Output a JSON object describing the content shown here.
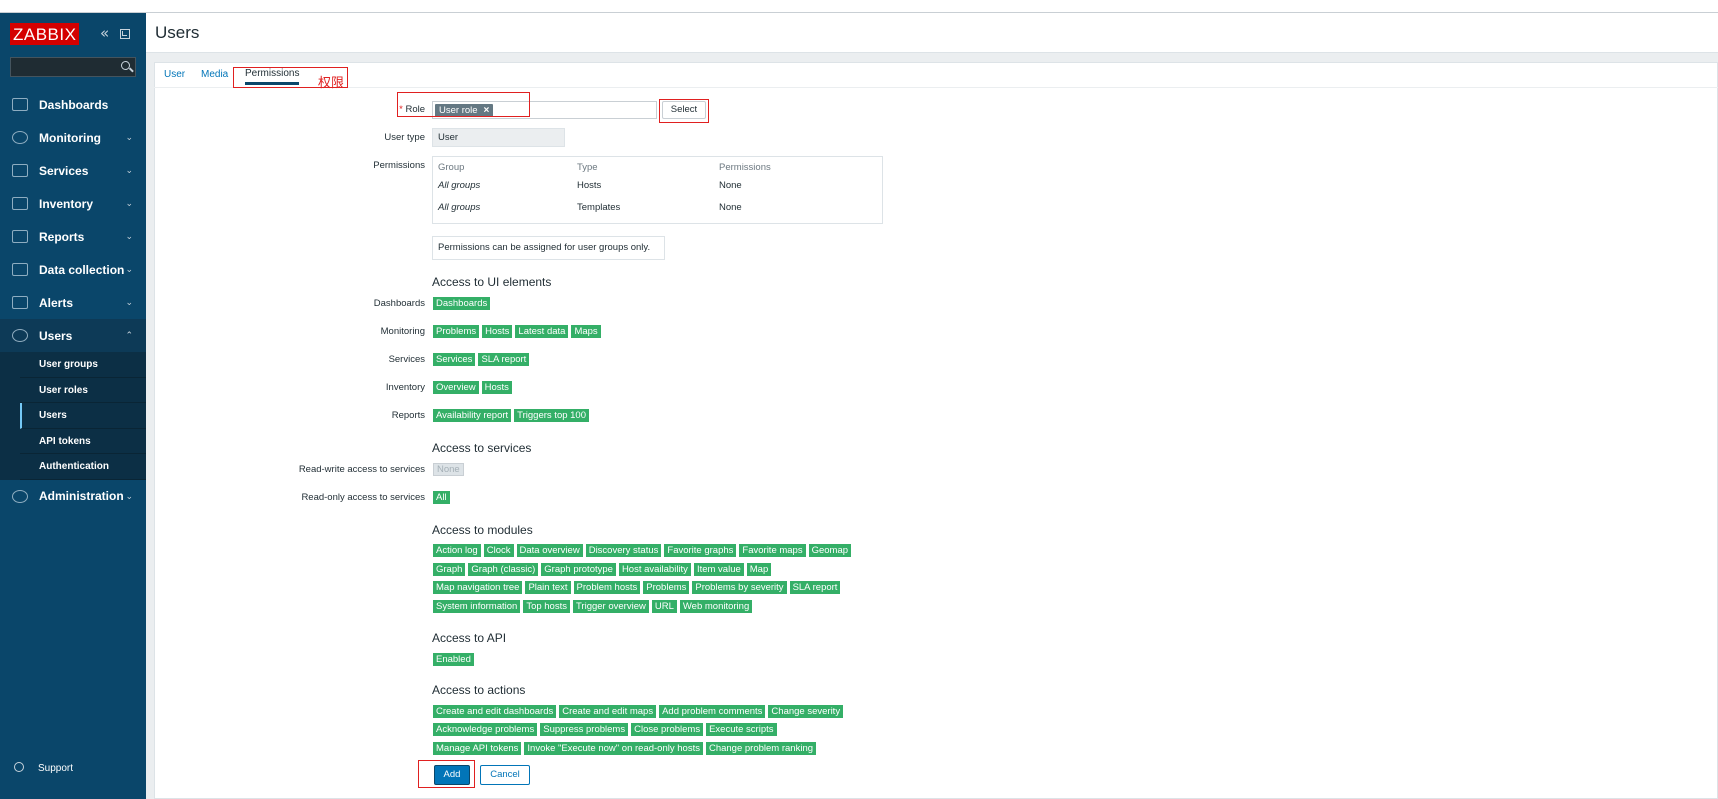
{
  "sidebar": {
    "logo": "ZABBIX",
    "menu": [
      {
        "label": "Dashboards",
        "icon": "dashboard-icon"
      },
      {
        "label": "Monitoring",
        "icon": "eye-icon"
      },
      {
        "label": "Services",
        "icon": "services-icon"
      },
      {
        "label": "Inventory",
        "icon": "list-icon"
      },
      {
        "label": "Reports",
        "icon": "report-icon"
      },
      {
        "label": "Data collection",
        "icon": "download-icon"
      },
      {
        "label": "Alerts",
        "icon": "envelope-icon"
      },
      {
        "label": "Users",
        "icon": "users-icon"
      }
    ],
    "users_submenu": [
      "User groups",
      "User roles",
      "Users",
      "API tokens",
      "Authentication"
    ],
    "administration": "Administration",
    "support": "Support"
  },
  "header": {
    "title": "Users"
  },
  "tabs": [
    "User",
    "Media",
    "Permissions"
  ],
  "annotation_text": "权限",
  "form": {
    "role_label": "Role",
    "role_required_mark": "*",
    "role_value": "User role",
    "role_remove": "×",
    "select_label": "Select",
    "user_type_label": "User type",
    "user_type_value": "User",
    "permissions_label": "Permissions",
    "perm_table": {
      "headers": [
        "Group",
        "Type",
        "Permissions"
      ],
      "rows": [
        [
          "All groups",
          "Hosts",
          "None"
        ],
        [
          "All groups",
          "Templates",
          "None"
        ]
      ]
    },
    "perm_note": "Permissions can be assigned for user groups only."
  },
  "ui_elements": {
    "title": "Access to UI elements",
    "rows": [
      {
        "label": "Dashboards",
        "tags": [
          "Dashboards"
        ]
      },
      {
        "label": "Monitoring",
        "tags": [
          "Problems",
          "Hosts",
          "Latest data",
          "Maps"
        ]
      },
      {
        "label": "Services",
        "tags": [
          "Services",
          "SLA report"
        ]
      },
      {
        "label": "Inventory",
        "tags": [
          "Overview",
          "Hosts"
        ]
      },
      {
        "label": "Reports",
        "tags": [
          "Availability report",
          "Triggers top 100"
        ]
      }
    ]
  },
  "services": {
    "title": "Access to services",
    "rw_label": "Read-write access to services",
    "rw_value": "None",
    "ro_label": "Read-only access to services",
    "ro_value": "All"
  },
  "modules": {
    "title": "Access to modules",
    "rows": [
      [
        "Action log",
        "Clock",
        "Data overview",
        "Discovery status",
        "Favorite graphs",
        "Favorite maps",
        "Geomap"
      ],
      [
        "Graph",
        "Graph (classic)",
        "Graph prototype",
        "Host availability",
        "Item value",
        "Map"
      ],
      [
        "Map navigation tree",
        "Plain text",
        "Problem hosts",
        "Problems",
        "Problems by severity",
        "SLA report"
      ],
      [
        "System information",
        "Top hosts",
        "Trigger overview",
        "URL",
        "Web monitoring"
      ]
    ]
  },
  "api": {
    "title": "Access to API",
    "value": "Enabled"
  },
  "actions": {
    "title": "Access to actions",
    "rows": [
      [
        "Create and edit dashboards",
        "Create and edit maps",
        "Add problem comments",
        "Change severity"
      ],
      [
        "Acknowledge problems",
        "Suppress problems",
        "Close problems",
        "Execute scripts"
      ],
      [
        "Manage API tokens",
        "Invoke \"Execute now\" on read-only hosts",
        "Change problem ranking"
      ]
    ]
  },
  "buttons": {
    "add": "Add",
    "cancel": "Cancel"
  },
  "colors": {
    "sidebar": "#0a466a",
    "accent": "#0275b8",
    "tag_green": "#34af67",
    "logo_red": "#d40000",
    "annotation_red": "#e02020"
  }
}
